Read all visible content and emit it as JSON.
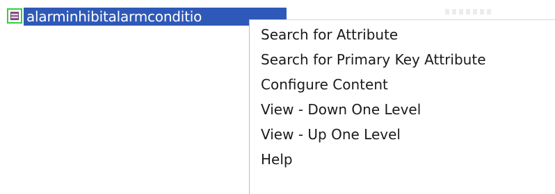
{
  "tree_node": {
    "label": "alarminhibitalarmconditio",
    "icon": "table-icon"
  },
  "context_menu": {
    "items": [
      {
        "label": "Search for Attribute"
      },
      {
        "label": "Search for Primary Key Attribute"
      },
      {
        "label": "Configure Content"
      },
      {
        "label": "View - Down One Level"
      },
      {
        "label": "View -  Up  One Level"
      },
      {
        "label": "Help"
      }
    ]
  },
  "colors": {
    "selection_bg": "#2f59b8",
    "selection_text": "#ffffff",
    "focus_outline": "#2fd13a",
    "menu_bg": "#ffffff",
    "menu_text": "#1a1a1a"
  }
}
